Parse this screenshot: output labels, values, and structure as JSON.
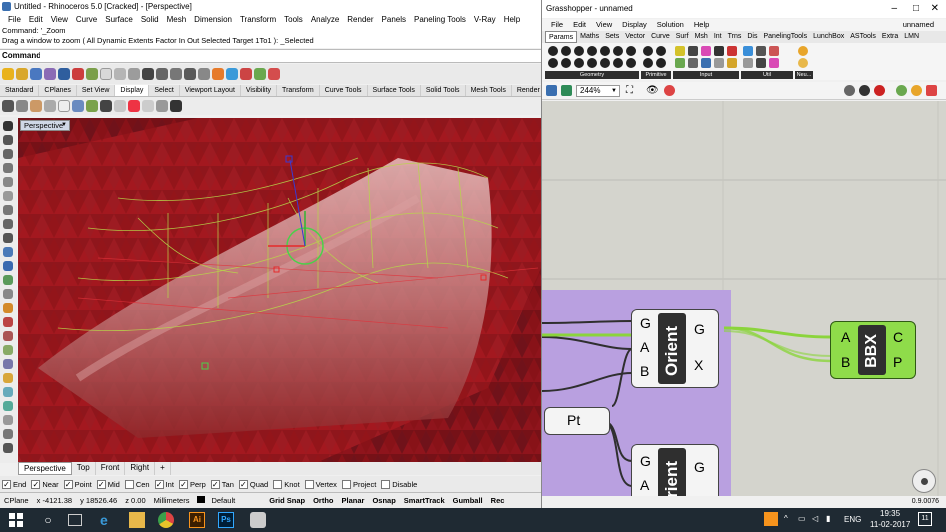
{
  "rhino": {
    "title": "Untitled - Rhinoceros 5.0 [Cracked] - [Perspective]",
    "menu": [
      "File",
      "Edit",
      "View",
      "Curve",
      "Surface",
      "Solid",
      "Mesh",
      "Dimension",
      "Transform",
      "Tools",
      "Analyze",
      "Render",
      "Panels",
      "Paneling Tools",
      "V-Ray",
      "Help"
    ],
    "command_history": [
      "Command: '_Zoom",
      "Drag a window to zoom ( All  Dynamic  Extents  Factor  In  Out  Selected  Target  1To1 ): _Selected"
    ],
    "command_label": "Command:",
    "command_value": "",
    "tabs": [
      "Standard",
      "CPlanes",
      "Set View",
      "Display",
      "Select",
      "Viewport Layout",
      "Visibility",
      "Transform",
      "Curve Tools",
      "Surface Tools",
      "Solid Tools",
      "Mesh Tools",
      "Render Too"
    ],
    "active_tab": "Display",
    "viewport_label": "Perspective",
    "viewport_tabs": [
      "Perspective",
      "Top",
      "Front",
      "Right"
    ],
    "viewport_tab_add": "+",
    "osnaps": [
      {
        "label": "End",
        "checked": true
      },
      {
        "label": "Near",
        "checked": true
      },
      {
        "label": "Point",
        "checked": true
      },
      {
        "label": "Mid",
        "checked": true
      },
      {
        "label": "Cen",
        "checked": false
      },
      {
        "label": "Int",
        "checked": true
      },
      {
        "label": "Perp",
        "checked": true
      },
      {
        "label": "Tan",
        "checked": true
      },
      {
        "label": "Quad",
        "checked": true
      },
      {
        "label": "Knot",
        "checked": false
      },
      {
        "label": "Vertex",
        "checked": false
      },
      {
        "label": "Project",
        "checked": false
      },
      {
        "label": "Disable",
        "checked": false
      }
    ],
    "status": {
      "cplane": "CPlane",
      "x": "x -4121.38",
      "y": "y 18526.46",
      "z": "z 0.00",
      "units": "Millimeters",
      "layer": "Default",
      "toggles": [
        "Grid Snap",
        "Ortho",
        "Planar",
        "Osnap",
        "SmartTrack",
        "Gumball",
        "Rec"
      ]
    },
    "colors": {
      "viewport_bg": "#6b0d12",
      "mesh_red": "#c21a22",
      "curve_green": "#9acd32"
    }
  },
  "grasshopper": {
    "title": "Grasshopper - unnamed",
    "menu": [
      "File",
      "Edit",
      "View",
      "Display",
      "Solution",
      "Help"
    ],
    "doc_name": "unnamed",
    "tabs": [
      "Params",
      "Maths",
      "Sets",
      "Vector",
      "Curve",
      "Surf",
      "Msh",
      "Int",
      "Trns",
      "Dis",
      "PanelingTools",
      "LunchBox",
      "ASTools",
      "Extra",
      "LMN"
    ],
    "active_tab": "Params",
    "ribbon_groups": [
      "Geometry",
      "Primitive",
      "Input",
      "Util",
      "Neu..."
    ],
    "zoom": "244%",
    "components": {
      "orient1": {
        "name": "Orient",
        "inputs": [
          "G",
          "A",
          "B"
        ],
        "outputs": [
          "G",
          "X"
        ]
      },
      "orient2": {
        "name": "Orient",
        "inputs": [
          "G",
          "A"
        ],
        "outputs": [
          "G"
        ]
      },
      "bbx": {
        "name": "BBX",
        "inputs": [
          "A",
          "B"
        ],
        "outputs": [
          "C",
          "P"
        ]
      },
      "pt": {
        "name": "Pt"
      }
    },
    "version": "0.9.0076",
    "colors": {
      "group_purple": "#b9a0e0",
      "bbx_green": "#8fdc4a",
      "wire_green": "#8bd43c"
    }
  },
  "taskbar": {
    "language": "ENG",
    "time": "19:35",
    "date": "11-02-2017",
    "notification_count": "11"
  }
}
